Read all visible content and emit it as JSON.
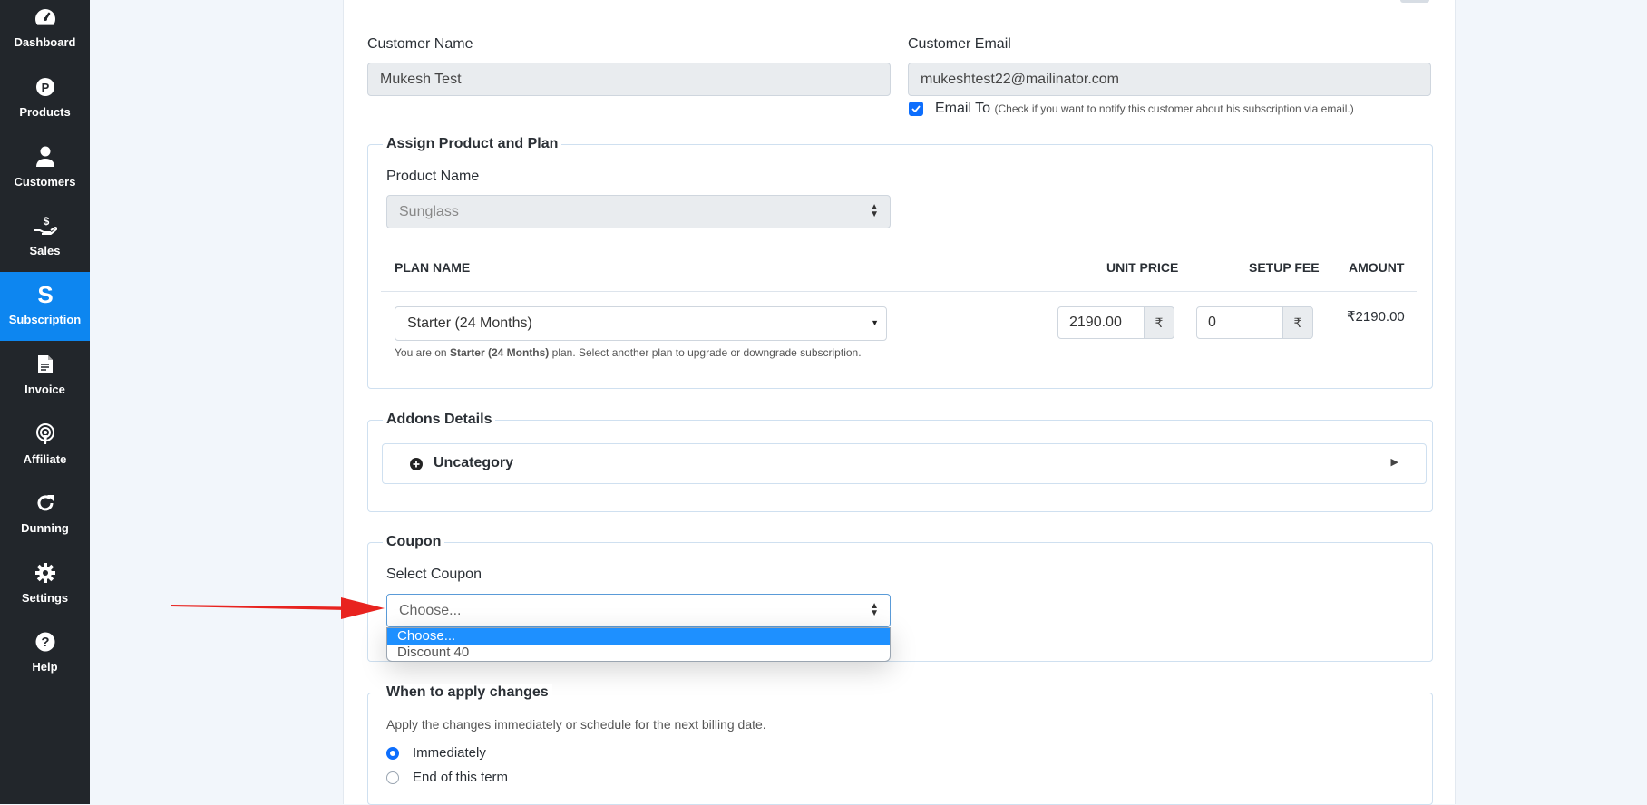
{
  "sidebar": {
    "items": [
      {
        "label": "Dashboard",
        "icon": "dashboard-icon"
      },
      {
        "label": "Products",
        "icon": "products-icon"
      },
      {
        "label": "Customers",
        "icon": "customers-icon"
      },
      {
        "label": "Sales",
        "icon": "sales-icon"
      },
      {
        "label": "Subscription",
        "icon": "subscription-icon",
        "active": true
      },
      {
        "label": "Invoice",
        "icon": "invoice-icon"
      },
      {
        "label": "Affiliate",
        "icon": "affiliate-icon"
      },
      {
        "label": "Dunning",
        "icon": "dunning-icon"
      },
      {
        "label": "Settings",
        "icon": "settings-icon"
      },
      {
        "label": "Help",
        "icon": "help-icon"
      }
    ],
    "active_color": "#0d86f0"
  },
  "customer": {
    "name_label": "Customer Name",
    "name_value": "Mukesh Test",
    "email_label": "Customer Email",
    "email_value": "mukeshtest22@mailinator.com",
    "email_to_label": "Email To",
    "email_to_hint": "(Check if you want to notify this customer about his subscription via email.)",
    "email_to_checked": true
  },
  "assign": {
    "legend": "Assign Product and Plan",
    "product_label": "Product Name",
    "product_value": "Sunglass",
    "col_plan": "PLAN NAME",
    "col_unit_price": "UNIT PRICE",
    "col_setup_fee": "SETUP FEE",
    "col_amount": "AMOUNT",
    "plan_value": "Starter (24 Months)",
    "unit_price": "2190.00",
    "currency_symbol": "₹",
    "setup_fee": "0",
    "amount": "₹2190.00",
    "note_prefix": "You are on ",
    "note_plan": "Starter (24 Months)",
    "note_suffix": " plan. Select another plan to upgrade or downgrade subscription."
  },
  "addons": {
    "legend": "Addons Details",
    "category": "Uncategory"
  },
  "coupon": {
    "legend": "Coupon",
    "select_label": "Select Coupon",
    "selected": "Choose...",
    "options": [
      "Choose...",
      "Discount 40"
    ]
  },
  "apply": {
    "legend": "When to apply changes",
    "description": "Apply the changes immediately or schedule for the next billing date.",
    "option_immediately": "Immediately",
    "option_end_of_term": "End of this term",
    "selected": "Immediately"
  },
  "annotation": {
    "arrow_color": "#e8231f"
  }
}
